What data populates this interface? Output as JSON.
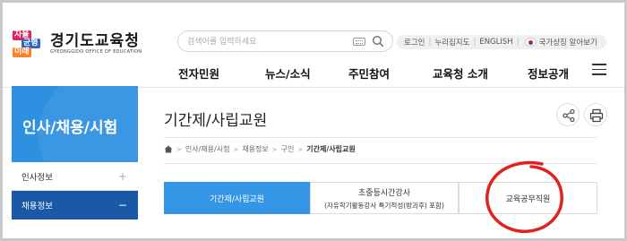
{
  "header": {
    "logo_badge": [
      "자율",
      "균형",
      "미래"
    ],
    "logo_name": "경기도교육청",
    "logo_sub": "GYEONGGIDO OFFICE OF EDUCATION",
    "search_placeholder": "검색어를 입력하세요",
    "util": {
      "login": "로그인",
      "sitemap": "누리집지도",
      "english": "ENGLISH",
      "national_symbol": "국가상징 알아보기"
    },
    "gnb": [
      "전자민원",
      "뉴스/소식",
      "주민참여",
      "교육청 소개",
      "정보공개"
    ]
  },
  "sidebar": {
    "title": "인사/채용/시험",
    "items": [
      {
        "label": "인사정보",
        "toggle": "+"
      },
      {
        "label": "채용정보",
        "toggle": "−"
      }
    ]
  },
  "main": {
    "page_title": "기간제/사립교원",
    "breadcrumb": [
      "인사/채용/시험",
      "채용정보",
      "구인",
      "기간제/사립교원"
    ],
    "tabs": [
      {
        "label": "기간제/사립교원",
        "sub": ""
      },
      {
        "label": "초중등시간강사",
        "sub": "(자유학기활동강사 특기적성(방과후) 포함)"
      },
      {
        "label": "교육공무직원",
        "sub": ""
      }
    ]
  },
  "colors": {
    "side_title_bg": "#2e90e0",
    "side_active_bg": "#1c58a8",
    "tab_active_bg": "#3596e6",
    "annotation_circle": "#e0231f"
  }
}
